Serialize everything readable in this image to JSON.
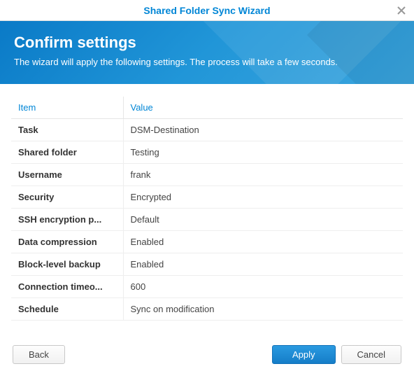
{
  "titlebar": {
    "title": "Shared Folder Sync Wizard"
  },
  "banner": {
    "title": "Confirm settings",
    "subtitle": "The wizard will apply the following settings. The process will take a few seconds."
  },
  "table": {
    "headers": {
      "item": "Item",
      "value": "Value"
    },
    "rows": [
      {
        "item": "Task",
        "value": "DSM-Destination"
      },
      {
        "item": "Shared folder",
        "value": "Testing"
      },
      {
        "item": "Username",
        "value": "frank"
      },
      {
        "item": "Security",
        "value": "Encrypted"
      },
      {
        "item": "SSH encryption p...",
        "value": "Default"
      },
      {
        "item": "Data compression",
        "value": "Enabled"
      },
      {
        "item": "Block-level backup",
        "value": "Enabled"
      },
      {
        "item": "Connection timeo...",
        "value": "600"
      },
      {
        "item": "Schedule",
        "value": "Sync on modification"
      }
    ]
  },
  "footer": {
    "back": "Back",
    "apply": "Apply",
    "cancel": "Cancel"
  }
}
